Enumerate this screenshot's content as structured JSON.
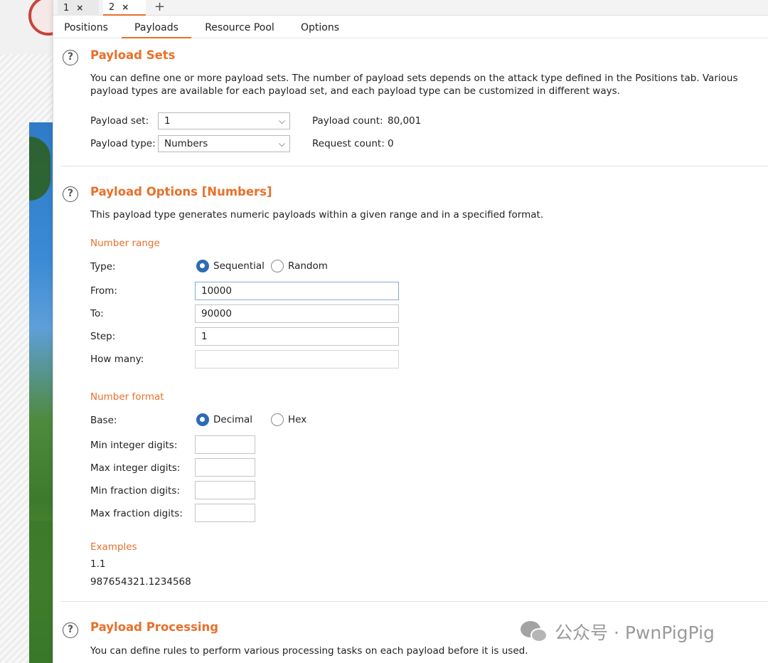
{
  "instance_tabs": [
    {
      "label": "1",
      "close": "×"
    },
    {
      "label": "2",
      "close": "×"
    }
  ],
  "add_tab": "+",
  "sub_tabs": {
    "positions": "Positions",
    "payloads": "Payloads",
    "resource_pool": "Resource Pool",
    "options": "Options",
    "active": "Payloads"
  },
  "help_glyph": "?",
  "payload_sets": {
    "title": "Payload Sets",
    "description": "You can define one or more payload sets. The number of payload sets depends on the attack type defined in the Positions tab. Various payload types are available for each payload set, and each payload type can be customized in different ways.",
    "payload_set_label": "Payload set:",
    "payload_set_value": "1",
    "payload_type_label": "Payload type:",
    "payload_type_value": "Numbers",
    "payload_count_label": "Payload count:",
    "payload_count_value": "80,001",
    "request_count_label": "Request count:",
    "request_count_value": "0"
  },
  "payload_options": {
    "title": "Payload Options [Numbers]",
    "description": "This payload type generates numeric payloads within a given range and in a specified format.",
    "number_range_heading": "Number range",
    "type_label": "Type:",
    "type_options": [
      "Sequential",
      "Random"
    ],
    "type_selected": "Sequential",
    "from_label": "From:",
    "from_value": "10000",
    "to_label": "To:",
    "to_value": "90000",
    "step_label": "Step:",
    "step_value": "1",
    "how_many_label": "How many:",
    "how_many_value": "",
    "number_format_heading": "Number format",
    "base_label": "Base:",
    "base_options": [
      "Decimal",
      "Hex"
    ],
    "base_selected": "Decimal",
    "min_integer_digits_label": "Min integer digits:",
    "max_integer_digits_label": "Max integer digits:",
    "min_fraction_digits_label": "Min fraction digits:",
    "max_fraction_digits_label": "Max fraction digits:",
    "examples_heading": "Examples",
    "examples": [
      "1.1",
      "987654321.1234568"
    ]
  },
  "payload_processing": {
    "title": "Payload Processing",
    "description": "You can define rules to perform various processing tasks on each payload before it is used."
  },
  "watermark": {
    "text": "公众号 · PwnPigPig"
  },
  "colors": {
    "accent": "#e8702a",
    "radio_selected": "#2d6bb2"
  }
}
